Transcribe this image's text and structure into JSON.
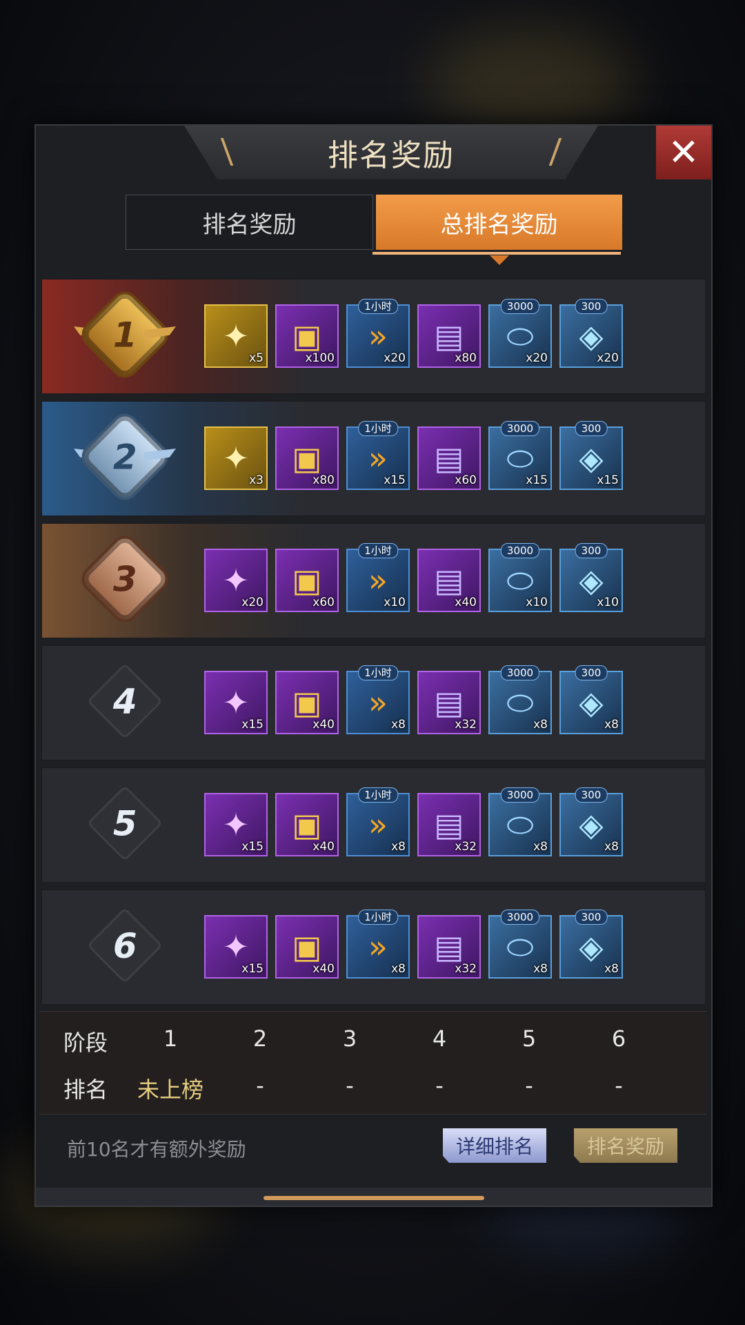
{
  "dialog": {
    "title": "排名奖励",
    "close_glyph": "✕"
  },
  "tabs": [
    {
      "label": "排名奖励",
      "active": false
    },
    {
      "label": "总排名奖励",
      "active": true
    }
  ],
  "colors": {
    "accent_orange": "#e8883a",
    "gold_text": "#e7cd80",
    "close_red": "#a8302c"
  },
  "item_types": {
    "badge": "wing-badge-icon",
    "chest": "gold-chest-icon",
    "speedup": "speedup-icon",
    "crate": "supply-crate-icon",
    "capsule": "capsule-icon",
    "platform": "teleport-platform-icon"
  },
  "tags": {
    "speedup": "1小时",
    "capsule": "3000",
    "platform": "300"
  },
  "rewards": [
    {
      "rank": "1",
      "qty": [
        "x5",
        "x100",
        "x20",
        "x80",
        "x20",
        "x20"
      ]
    },
    {
      "rank": "2",
      "qty": [
        "x3",
        "x80",
        "x15",
        "x60",
        "x15",
        "x15"
      ]
    },
    {
      "rank": "3",
      "qty": [
        "x20",
        "x60",
        "x10",
        "x40",
        "x10",
        "x10"
      ]
    },
    {
      "rank": "4",
      "qty": [
        "x15",
        "x40",
        "x8",
        "x32",
        "x8",
        "x8"
      ]
    },
    {
      "rank": "5",
      "qty": [
        "x15",
        "x40",
        "x8",
        "x32",
        "x8",
        "x8"
      ]
    },
    {
      "rank": "6",
      "qty": [
        "x15",
        "x40",
        "x8",
        "x32",
        "x8",
        "x8"
      ]
    }
  ],
  "stage_table": {
    "stage_label": "阶段",
    "rank_label": "排名",
    "stages": [
      "1",
      "2",
      "3",
      "4",
      "5",
      "6"
    ],
    "ranks": [
      "未上榜",
      "-",
      "-",
      "-",
      "-",
      "-"
    ]
  },
  "footer": {
    "note": "前10名才有额外奖励",
    "detail_button": "详细排名",
    "reward_button": "排名奖励"
  }
}
